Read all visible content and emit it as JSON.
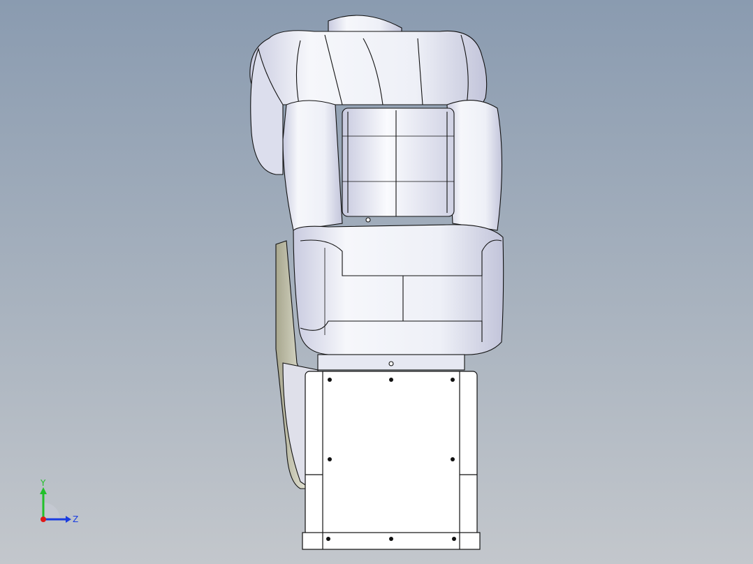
{
  "viewport": {
    "background_top": "#8a9bb0",
    "background_bottom": "#c3c7cc",
    "model_fill": "#f2f3f8",
    "model_shade": "#c9cbe0",
    "edge_color": "#111111"
  },
  "triad": {
    "y_label": "Y",
    "z_label": "Z",
    "y_color": "#22c02a",
    "z_color": "#1a3ce0",
    "x_color": "#e01818"
  }
}
